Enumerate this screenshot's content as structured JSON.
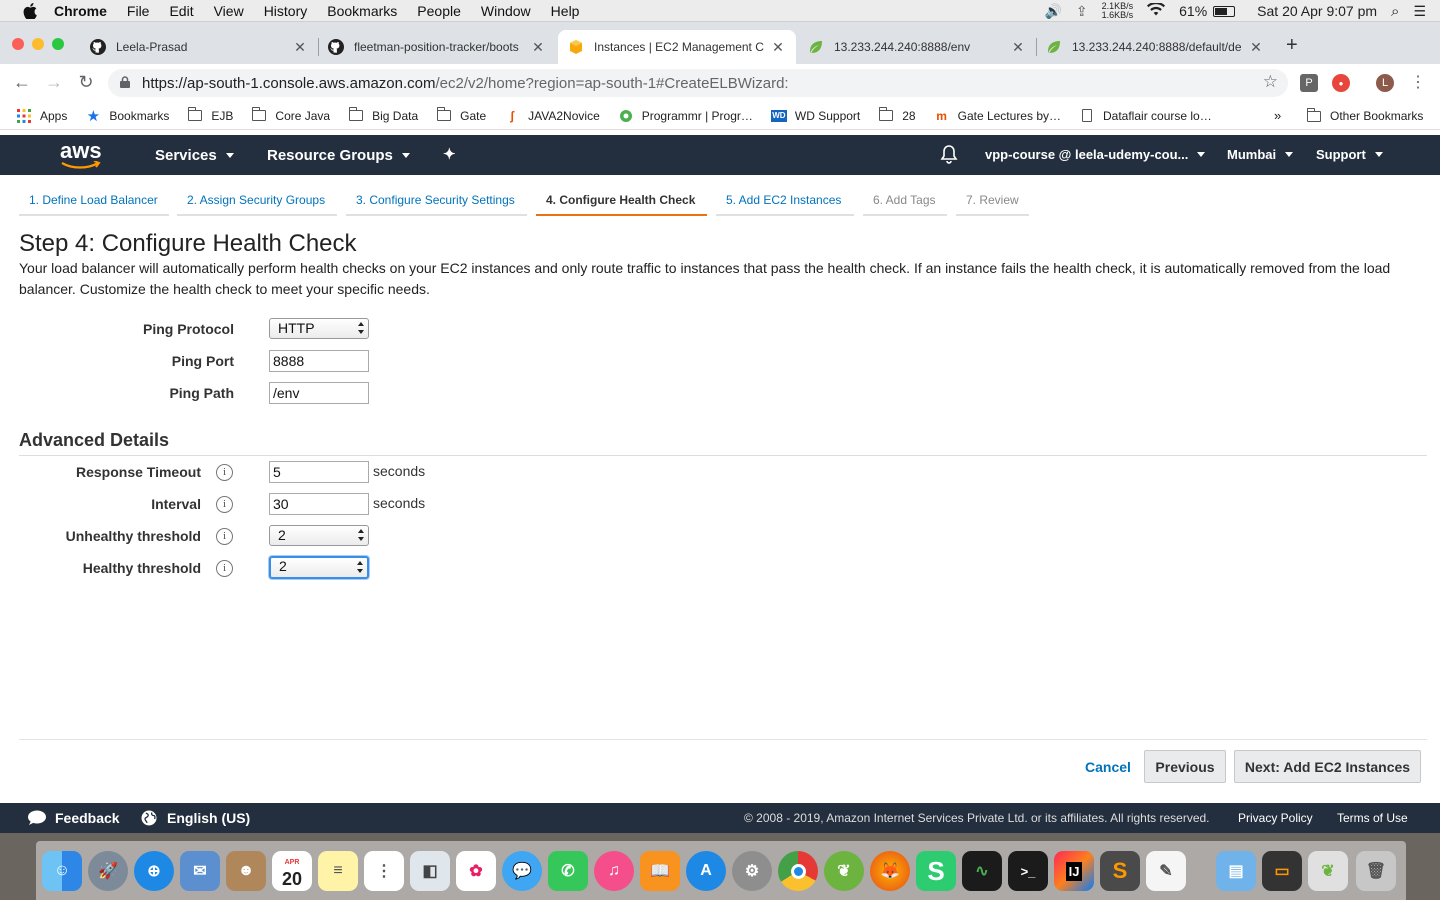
{
  "menubar": {
    "app": "Chrome",
    "items": [
      "File",
      "Edit",
      "View",
      "History",
      "Bookmarks",
      "People",
      "Window",
      "Help"
    ],
    "net_up": "2.1KB/s",
    "net_down": "1.6KB/s",
    "battery": "61%",
    "datetime": "Sat 20 Apr  9:07 pm"
  },
  "tabs": [
    {
      "title": "Leela-Prasad",
      "icon": "github-icon"
    },
    {
      "title": "fleetman-position-tracker/boots",
      "icon": "github-icon"
    },
    {
      "title": "Instances | EC2 Management C",
      "icon": "aws-cube-icon",
      "active": true
    },
    {
      "title": "13.233.244.240:8888/env",
      "icon": "spring-leaf-icon"
    },
    {
      "title": "13.233.244.240:8888/default/de",
      "icon": "spring-leaf-icon"
    }
  ],
  "omnibox": {
    "url_main": "https://ap-south-1.console.aws.amazon.com",
    "url_rest": "/ec2/v2/home?region=ap-south-1#CreateELBWizard:"
  },
  "extensions": {
    "p": "P",
    "avatar": "L"
  },
  "bookmarks": [
    {
      "label": "Apps",
      "icon": "apps-grid-icon"
    },
    {
      "label": "Bookmarks",
      "icon": "star-icon"
    },
    {
      "label": "EJB",
      "icon": "folder-icon"
    },
    {
      "label": "Core Java",
      "icon": "folder-icon"
    },
    {
      "label": "Big Data",
      "icon": "folder-icon"
    },
    {
      "label": "Gate",
      "icon": "folder-icon"
    },
    {
      "label": "JAVA2Novice",
      "icon": "java-icon"
    },
    {
      "label": "Programmr | Progr…",
      "icon": "programmr-icon"
    },
    {
      "label": "WD Support",
      "icon": "wd-icon"
    },
    {
      "label": "28",
      "icon": "folder-icon"
    },
    {
      "label": "Gate Lectures by…",
      "icon": "nptel-icon"
    },
    {
      "label": "Dataflair course lo…",
      "icon": "page-icon"
    }
  ],
  "bookmarks_overflow": "»",
  "other_bookmarks": "Other Bookmarks",
  "awsnav": {
    "logo": "aws",
    "services": "Services",
    "resource_groups": "Resource Groups",
    "account": "vpp-course @ leela-udemy-cou...",
    "region": "Mumbai",
    "support": "Support"
  },
  "wizard_steps": [
    {
      "label": "1. Define Load Balancer",
      "state": "link"
    },
    {
      "label": "2. Assign Security Groups",
      "state": "link"
    },
    {
      "label": "3. Configure Security Settings",
      "state": "link"
    },
    {
      "label": "4. Configure Health Check",
      "state": "active"
    },
    {
      "label": "5. Add EC2 Instances",
      "state": "link"
    },
    {
      "label": "6. Add Tags",
      "state": "disabled"
    },
    {
      "label": "7. Review",
      "state": "disabled"
    }
  ],
  "page": {
    "title": "Step 4: Configure Health Check",
    "description": "Your load balancer will automatically perform health checks on your EC2 instances and only route traffic to instances that pass the health check. If an instance fails the health check, it is automatically removed from the load balancer. Customize the health check to meet your specific needs."
  },
  "form": {
    "ping_protocol": {
      "label": "Ping Protocol",
      "value": "HTTP"
    },
    "ping_port": {
      "label": "Ping Port",
      "value": "8888"
    },
    "ping_path": {
      "label": "Ping Path",
      "value": "/env"
    }
  },
  "advanced": {
    "heading": "Advanced Details",
    "response_timeout": {
      "label": "Response Timeout",
      "value": "5",
      "unit": "seconds"
    },
    "interval": {
      "label": "Interval",
      "value": "30",
      "unit": "seconds"
    },
    "unhealthy_threshold": {
      "label": "Unhealthy threshold",
      "value": "2"
    },
    "healthy_threshold": {
      "label": "Healthy threshold",
      "value": "2"
    }
  },
  "buttons": {
    "cancel": "Cancel",
    "previous": "Previous",
    "next": "Next: Add EC2 Instances"
  },
  "footer": {
    "feedback": "Feedback",
    "language": "English (US)",
    "copyright": "© 2008 - 2019, Amazon Internet Services Private Ltd. or its affiliates. All rights reserved.",
    "privacy": "Privacy Policy",
    "terms": "Terms of Use"
  },
  "dock": {
    "calendar_month": "APR",
    "calendar_day": "20"
  },
  "colors": {
    "aws_nav": "#232f3e",
    "aws_orange": "#ec7211",
    "link_blue": "#0073bb"
  }
}
